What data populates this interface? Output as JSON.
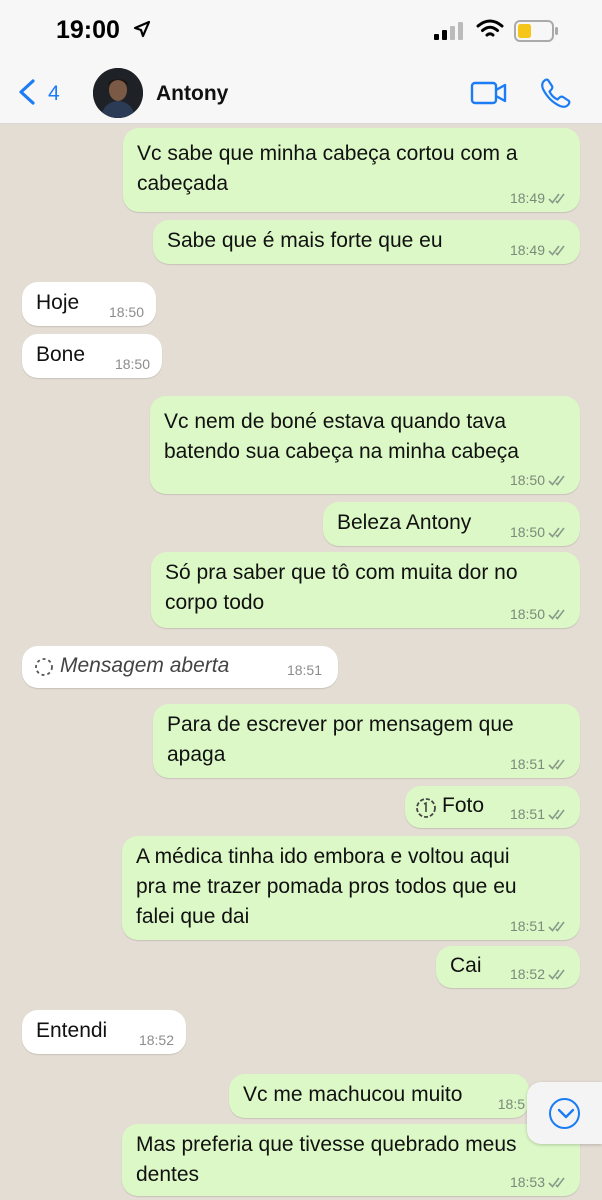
{
  "status_bar": {
    "time": "19:00"
  },
  "header": {
    "back_count": "4",
    "contact_name": "Antony"
  },
  "messages": [
    {
      "text": "Vc sabe que minha cabeça cortou com a\ncabeçada",
      "time": "18:49"
    },
    {
      "text": "Sabe que é mais forte que eu",
      "time": "18:49"
    },
    {
      "text": "Hoje",
      "time": "18:50"
    },
    {
      "text": "Bone",
      "time": "18:50"
    },
    {
      "text": "Vc nem de boné estava quando tava\nbatendo sua cabeça na minha cabeça",
      "time": "18:50"
    },
    {
      "text": "Beleza Antony",
      "time": "18:50"
    },
    {
      "text": "Só pra saber que tô com muita dor no\ncorpo todo",
      "time": "18:50"
    },
    {
      "text": "Mensagem aberta",
      "time": "18:51"
    },
    {
      "text": "Para de escrever por mensagem que\napaga",
      "time": "18:51"
    },
    {
      "text": "Foto",
      "time": "18:51"
    },
    {
      "text": "A médica tinha ido embora e voltou aqui\npra me trazer pomada pros todos que eu\nfalei que dai",
      "time": "18:51"
    },
    {
      "text": "Cai",
      "time": "18:52"
    },
    {
      "text": "Entendi",
      "time": "18:52"
    },
    {
      "text": "Vc me machucou muito",
      "time": "18:5"
    },
    {
      "text": "Mas preferia que tivesse quebrado meus\ndentes",
      "time": "18:53"
    }
  ]
}
